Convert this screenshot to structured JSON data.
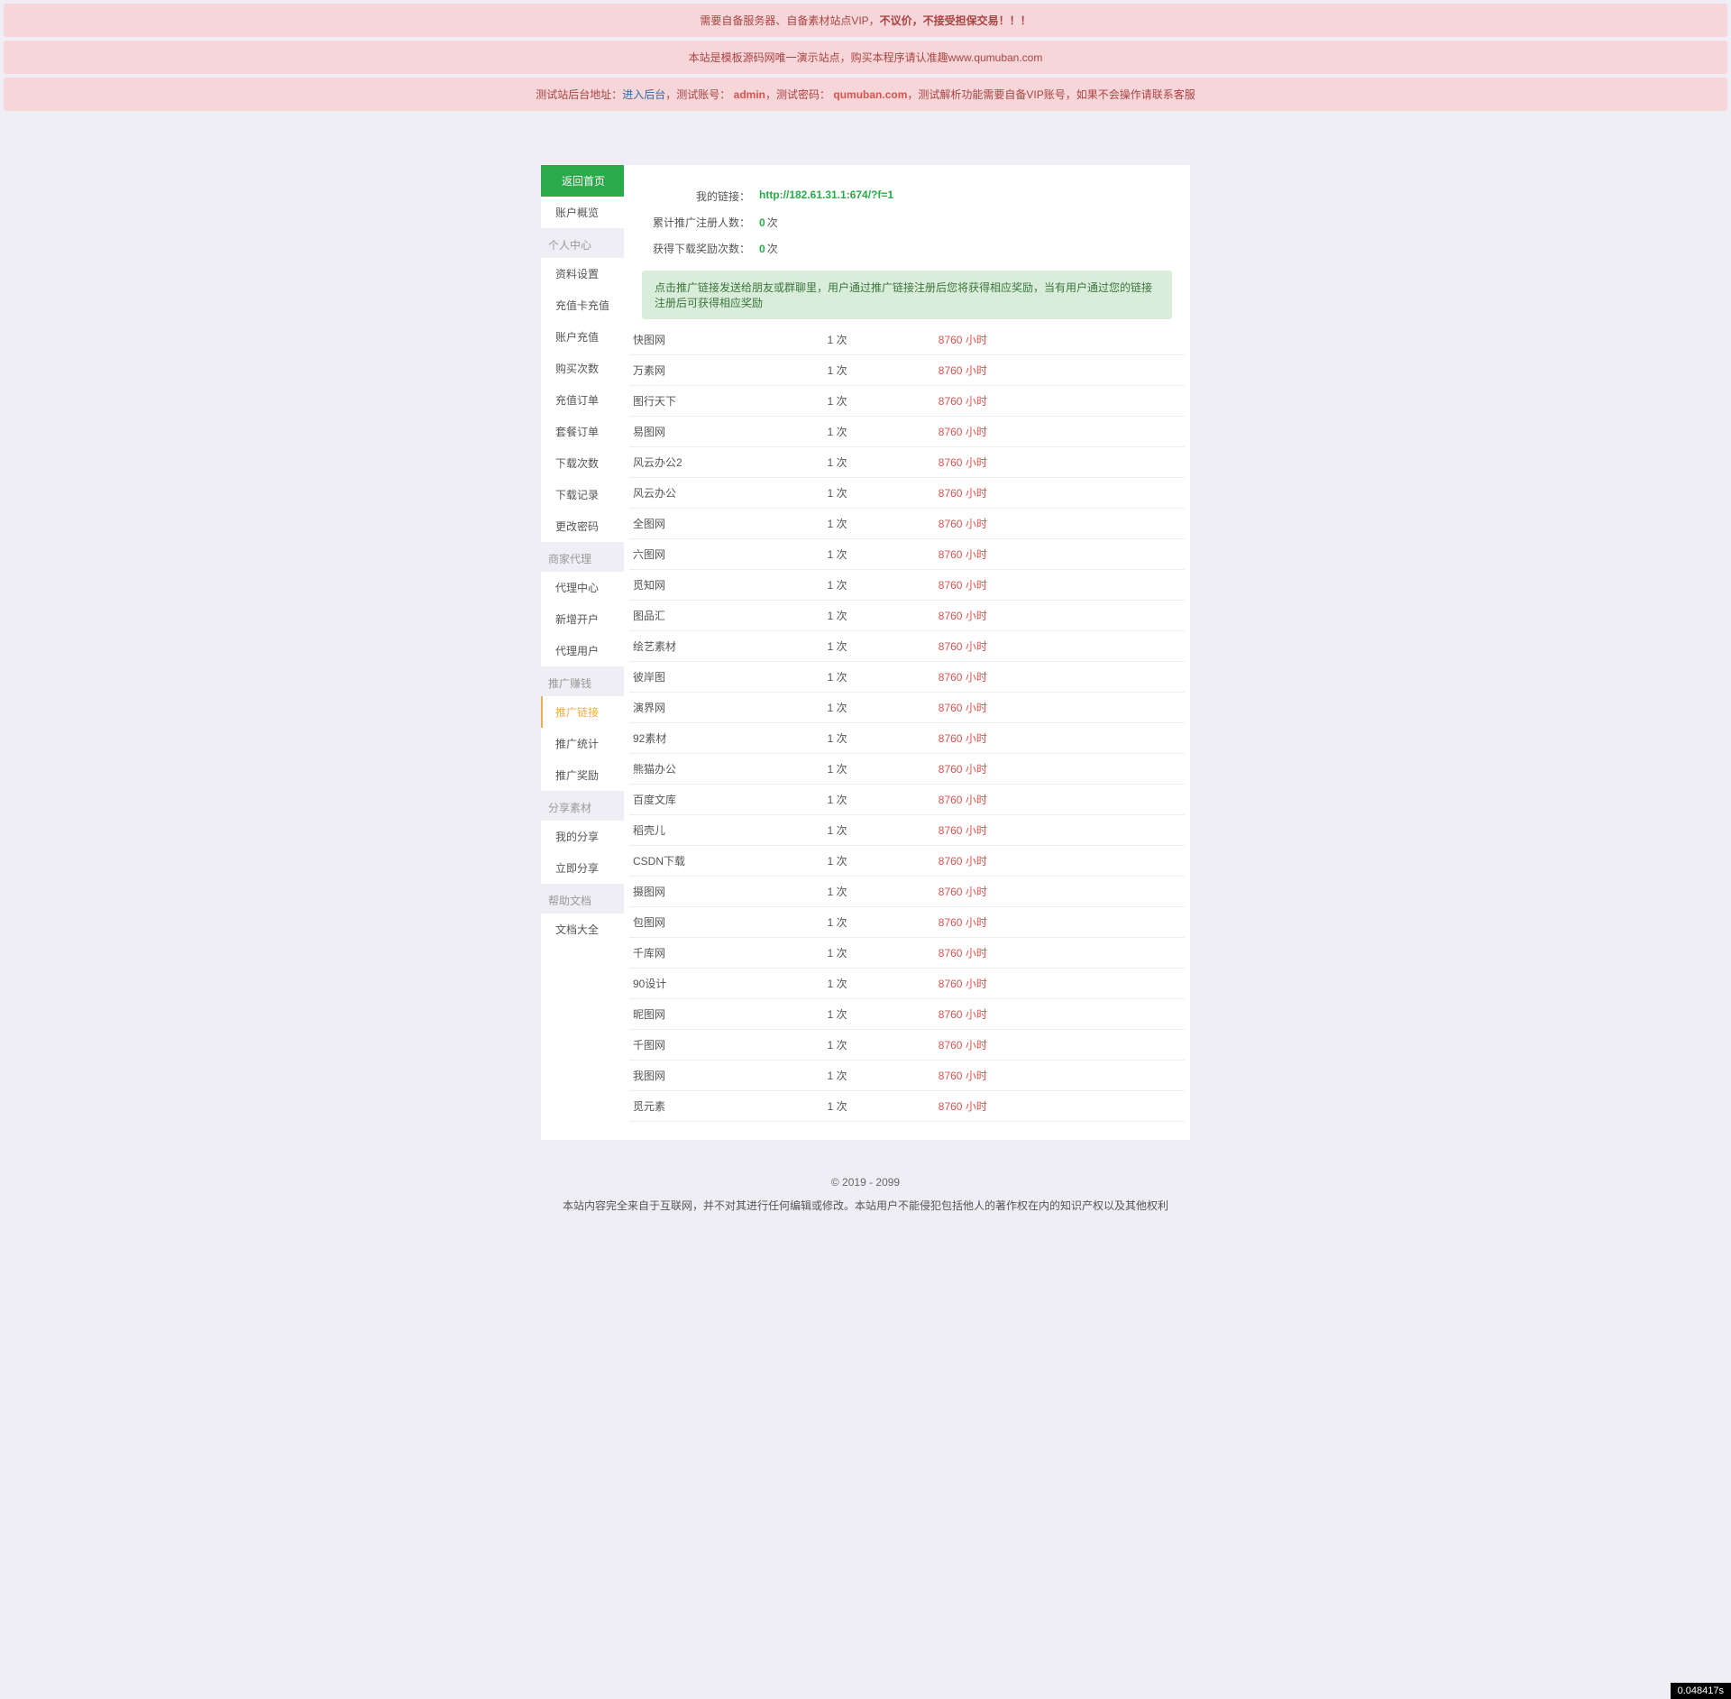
{
  "alerts": {
    "a1_pre": "需要自备服务器、自备素材站点VIP，",
    "a1_bold": "不议价，不接受担保交易！！！",
    "a2": "本站是模板源码网唯一演示站点，购买本程序请认准趣www.qumuban.com",
    "a3_p1": "测试站后台地址：",
    "a3_link": "进入后台",
    "a3_p2": "，测试账号：",
    "a3_admin": "admin",
    "a3_p3": "，测试密码：",
    "a3_pwd": "qumuban.com",
    "a3_p4": "，测试解析功能需要自备VIP账号，如果不会操作请联系客服"
  },
  "sidebar": {
    "home": "返回首页",
    "overview": "账户概览",
    "sec_personal": "个人中心",
    "profile": "资料设置",
    "recharge_card": "充值卡充值",
    "account_recharge": "账户充值",
    "buy_count": "购买次数",
    "recharge_order": "充值订单",
    "package_order": "套餐订单",
    "download_count": "下载次数",
    "download_log": "下载记录",
    "change_pwd": "更改密码",
    "sec_agent": "商家代理",
    "agent_center": "代理中心",
    "new_account": "新增开户",
    "agent_user": "代理用户",
    "sec_promo": "推广赚钱",
    "promo_link": "推广链接",
    "promo_stats": "推广统计",
    "promo_reward": "推广奖励",
    "sec_share": "分享素材",
    "my_share": "我的分享",
    "share_now": "立即分享",
    "sec_help": "帮助文档",
    "doc_all": "文档大全"
  },
  "info": {
    "link_label": "我的链接：",
    "link_value": "http://182.61.31.1:674/?f=1",
    "reg_label": "累计推广注册人数：",
    "reg_value": "0",
    "reward_label": "获得下载奖励次数：",
    "reward_value": "0",
    "unit": "次"
  },
  "notice": "点击推广链接发送给朋友或群聊里，用户通过推广链接注册后您将获得相应奖励，当有用户通过您的链接注册后可获得相应奖励",
  "unit_times": "次",
  "unit_hours": "小时",
  "rows": [
    {
      "name": "快图网",
      "count": "1",
      "hours": "8760"
    },
    {
      "name": "万素网",
      "count": "1",
      "hours": "8760"
    },
    {
      "name": "图行天下",
      "count": "1",
      "hours": "8760"
    },
    {
      "name": "易图网",
      "count": "1",
      "hours": "8760"
    },
    {
      "name": "风云办公2",
      "count": "1",
      "hours": "8760"
    },
    {
      "name": "风云办公",
      "count": "1",
      "hours": "8760"
    },
    {
      "name": "全图网",
      "count": "1",
      "hours": "8760"
    },
    {
      "name": "六图网",
      "count": "1",
      "hours": "8760"
    },
    {
      "name": "觅知网",
      "count": "1",
      "hours": "8760"
    },
    {
      "name": "图品汇",
      "count": "1",
      "hours": "8760"
    },
    {
      "name": "绘艺素材",
      "count": "1",
      "hours": "8760"
    },
    {
      "name": "彼岸图",
      "count": "1",
      "hours": "8760"
    },
    {
      "name": "演界网",
      "count": "1",
      "hours": "8760"
    },
    {
      "name": "92素材",
      "count": "1",
      "hours": "8760"
    },
    {
      "name": "熊猫办公",
      "count": "1",
      "hours": "8760"
    },
    {
      "name": "百度文库",
      "count": "1",
      "hours": "8760"
    },
    {
      "name": "稻壳儿",
      "count": "1",
      "hours": "8760"
    },
    {
      "name": "CSDN下载",
      "count": "1",
      "hours": "8760"
    },
    {
      "name": "摄图网",
      "count": "1",
      "hours": "8760"
    },
    {
      "name": "包图网",
      "count": "1",
      "hours": "8760"
    },
    {
      "name": "千库网",
      "count": "1",
      "hours": "8760"
    },
    {
      "name": "90设计",
      "count": "1",
      "hours": "8760"
    },
    {
      "name": "昵图网",
      "count": "1",
      "hours": "8760"
    },
    {
      "name": "千图网",
      "count": "1",
      "hours": "8760"
    },
    {
      "name": "我图网",
      "count": "1",
      "hours": "8760"
    },
    {
      "name": "觅元素",
      "count": "1",
      "hours": "8760"
    }
  ],
  "footer": "© 2019 - 2099",
  "footer_sub": "本站内容完全来自于互联网，并不对其进行任何编辑或修改。本站用户不能侵犯包括他人的著作权在内的知识产权以及其他权利",
  "perf": "0.048417s"
}
